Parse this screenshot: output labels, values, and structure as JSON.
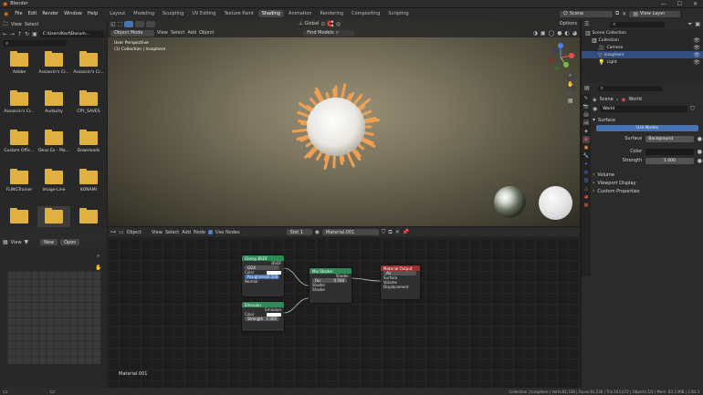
{
  "app": {
    "title": "Blender"
  },
  "menubar": {
    "menus": [
      "File",
      "Edit",
      "Render",
      "Window",
      "Help"
    ],
    "workspaces": [
      "Layout",
      "Modeling",
      "Sculpting",
      "UV Editing",
      "Texture Paint",
      "Shading",
      "Animation",
      "Rendering",
      "Compositing",
      "Scripting"
    ],
    "active_workspace": "Shading",
    "scene": "Scene",
    "view_layer": "View Layer"
  },
  "file_browser": {
    "view_label": "View",
    "select_label": "Select",
    "path": "C:\\Users\\Kart\\Docum...",
    "folders": [
      "Adobe",
      "Assassin's Cr...",
      "Assassin's Cr...",
      "Assassin's Cr...",
      "Audacity",
      "CPY_SAVES",
      "Custom Offic...",
      "Deus Ex - Ma...",
      "Downloads",
      "FLINGTrainer",
      "Image-Line",
      "KONAMI",
      "",
      "",
      ""
    ],
    "selected_index": 13
  },
  "viewport": {
    "mode": "Object Mode",
    "menus": [
      "View",
      "Select",
      "Add",
      "Object"
    ],
    "orientation": "Global",
    "shading_nodes": "Find Models",
    "info_line1": "User Perspective",
    "info_line2": "(1) Collection | Icosphere",
    "options_label": "Options",
    "gizmo_axes": [
      "X",
      "Y",
      "Z"
    ]
  },
  "image_editor": {
    "view_label": "View",
    "new_label": "New",
    "open_label": "Open"
  },
  "node_editor": {
    "object_label": "Object",
    "menus": [
      "View",
      "Select",
      "Add",
      "Node"
    ],
    "use_nodes": "Use Nodes",
    "slot": "Slot 1",
    "material": "Material.001",
    "footer_label": "Material.001",
    "nodes": {
      "glossy": {
        "title": "Glossy BSDF",
        "out": "BSDF",
        "dist": "GGX",
        "color": "Color",
        "roughness": "Roughness",
        "roughness_val": "0.500",
        "normal": "Normal"
      },
      "emission": {
        "title": "Emission",
        "out": "Emission",
        "color": "Color",
        "strength": "Strength",
        "strength_val": "1.000"
      },
      "mix": {
        "title": "Mix Shader",
        "out": "Shader",
        "fac": "Fac",
        "fac_val": "0.500",
        "shader1": "Shader",
        "shader2": "Shader"
      },
      "output": {
        "title": "Material Output",
        "target": "All",
        "surface": "Surface",
        "volume": "Volume",
        "displacement": "Displacement"
      }
    }
  },
  "outliner": {
    "title": "Scene Collection",
    "items": [
      {
        "name": "Collection",
        "indent": 1,
        "selected": false
      },
      {
        "name": "Camera",
        "indent": 2,
        "selected": false
      },
      {
        "name": "Icosphere",
        "indent": 2,
        "selected": true
      },
      {
        "name": "Light",
        "indent": 2,
        "selected": false
      }
    ]
  },
  "properties": {
    "breadcrumb_scene": "Scene",
    "breadcrumb_world": "World",
    "world_name": "World",
    "surface_panel": "Surface",
    "use_nodes_btn": "Use Nodes",
    "surface_label": "Surface",
    "surface_value": "Background",
    "color_label": "Color",
    "strength_label": "Strength",
    "strength_value": "1.000",
    "panels": [
      "Volume",
      "Viewport Display",
      "Custom Properties"
    ]
  },
  "statusbar": {
    "text": "Collection | Icosphere | Verts:81,538 | Faces:81,536 | Tris:163,072 | Objects:1/3 | Mem: 83.3 MiB | 2.83.3"
  },
  "colors": {
    "accent": "#4772b3",
    "folder": "#e0b040",
    "glossy_header": "#2e8b57",
    "mix_header": "#2e8b57",
    "output_header": "#a03030"
  }
}
